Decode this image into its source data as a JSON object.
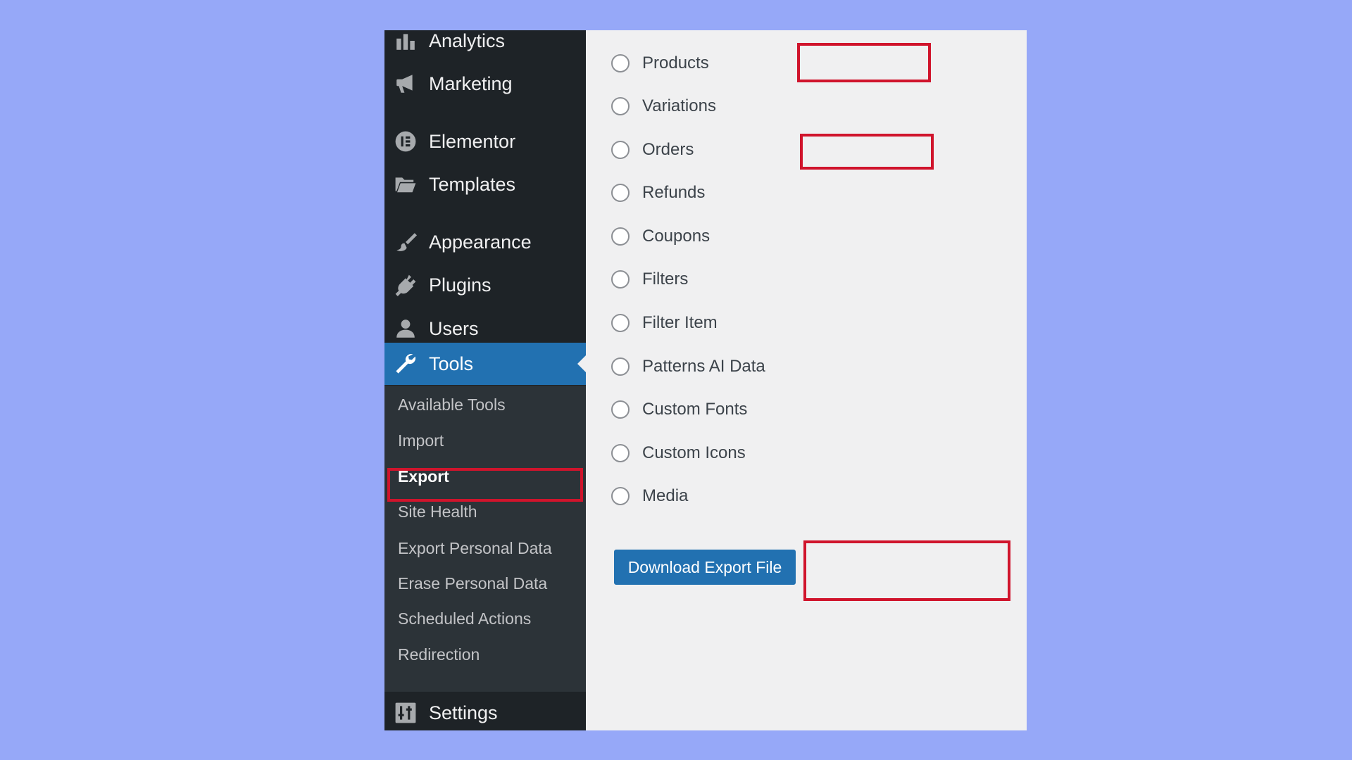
{
  "sidebar": {
    "menu": [
      {
        "label": "Analytics",
        "icon": "bar-chart-icon"
      },
      {
        "label": "Marketing",
        "icon": "megaphone-icon"
      },
      {
        "label": "Elementor",
        "icon": "elementor-icon"
      },
      {
        "label": "Templates",
        "icon": "folder-icon"
      },
      {
        "label": "Appearance",
        "icon": "paintbrush-icon"
      },
      {
        "label": "Plugins",
        "icon": "plug-icon"
      },
      {
        "label": "Users",
        "icon": "user-icon"
      },
      {
        "label": "Tools",
        "icon": "wrench-icon",
        "active": true
      },
      {
        "label": "Settings",
        "icon": "sliders-icon"
      }
    ],
    "tools_submenu": [
      {
        "label": "Available Tools"
      },
      {
        "label": "Import"
      },
      {
        "label": "Export",
        "current": true
      },
      {
        "label": "Site Health"
      },
      {
        "label": "Export Personal Data"
      },
      {
        "label": "Erase Personal Data"
      },
      {
        "label": "Scheduled Actions"
      },
      {
        "label": "Redirection"
      }
    ]
  },
  "export_options": [
    {
      "label": "Products",
      "highlighted": true
    },
    {
      "label": "Variations"
    },
    {
      "label": "Orders",
      "highlighted": true
    },
    {
      "label": "Refunds"
    },
    {
      "label": "Coupons"
    },
    {
      "label": "Filters"
    },
    {
      "label": "Filter Item"
    },
    {
      "label": "Patterns AI Data"
    },
    {
      "label": "Custom Fonts"
    },
    {
      "label": "Custom Icons"
    },
    {
      "label": "Media"
    }
  ],
  "download_button": {
    "label": "Download Export File",
    "highlighted": true
  },
  "colors": {
    "background": "#96a8f8",
    "sidebar": "#1e2327",
    "submenu": "#2c3338",
    "accent": "#2271b1",
    "content": "#f0f0f1",
    "highlight": "#d0142c"
  }
}
